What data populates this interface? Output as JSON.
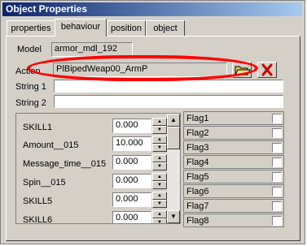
{
  "window": {
    "title": "Object Properties"
  },
  "tabs": [
    {
      "label": "properties"
    },
    {
      "label": "behaviour",
      "active": true
    },
    {
      "label": "position"
    },
    {
      "label": "object"
    }
  ],
  "fields": {
    "model_label": "Model",
    "model_value": "armor_mdl_192",
    "action_label": "Action",
    "action_value": "PlBipedWeap00_ArmP",
    "string1_label": "String 1",
    "string1_value": "",
    "string2_label": "String 2",
    "string2_value": ""
  },
  "params": [
    {
      "name": "SKILL1",
      "value": "0.000"
    },
    {
      "name": "Amount__015",
      "value": "10.000"
    },
    {
      "name": "Message_time__015",
      "value": "0.000"
    },
    {
      "name": "Spin__015",
      "value": "0.000"
    },
    {
      "name": "SKILL5",
      "value": "0.000"
    },
    {
      "name": "SKILL6",
      "value": "0.000"
    }
  ],
  "flags": [
    {
      "label": "Flag1",
      "checked": false
    },
    {
      "label": "Flag2",
      "checked": false
    },
    {
      "label": "Flag3",
      "checked": false
    },
    {
      "label": "Flag4",
      "checked": false
    },
    {
      "label": "Flag5",
      "checked": false
    },
    {
      "label": "Flag6",
      "checked": false
    },
    {
      "label": "Flag7",
      "checked": false
    },
    {
      "label": "Flag8",
      "checked": false
    }
  ],
  "icons": {
    "browse": "folder-open-icon",
    "clear": "red-x-icon"
  },
  "colors": {
    "titlebar_start": "#0a246a",
    "titlebar_end": "#a6caf0",
    "highlight": "#ff0000"
  }
}
